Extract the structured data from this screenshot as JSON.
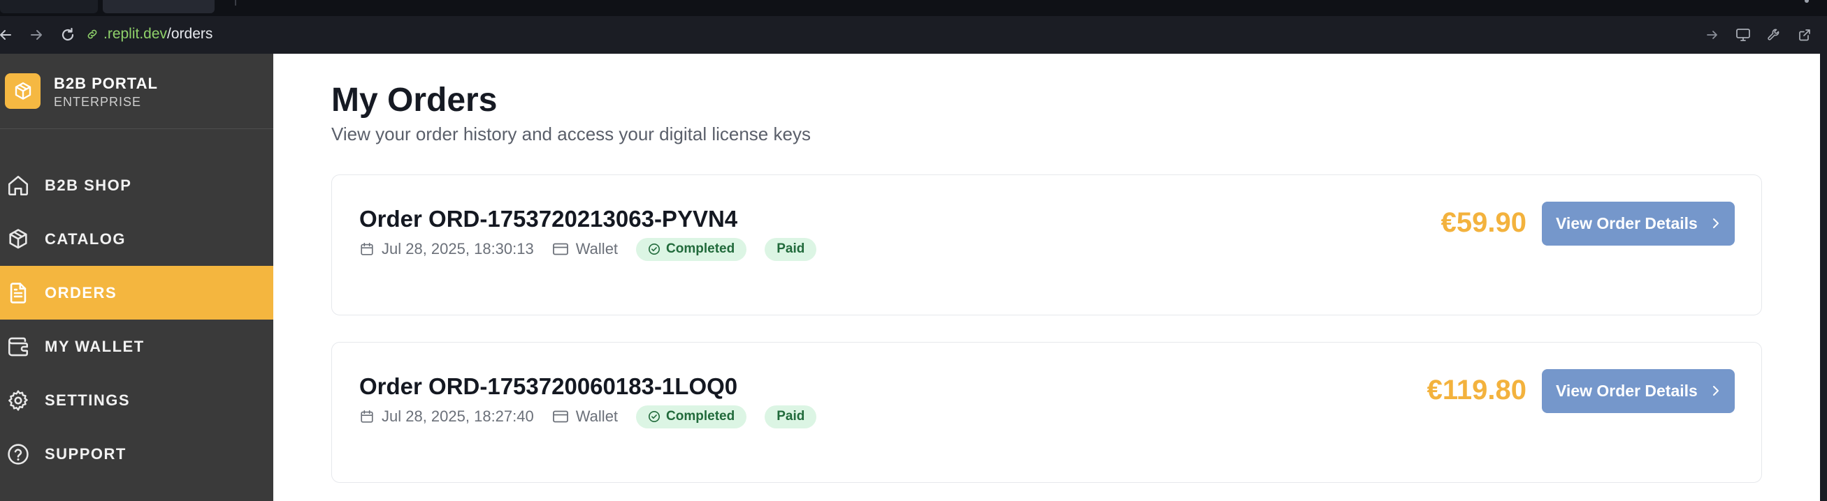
{
  "browser": {
    "url_host": ".replit.dev",
    "url_path": "/orders"
  },
  "sidebar": {
    "brand_title": "B2B PORTAL",
    "brand_subtitle": "ENTERPRISE",
    "items": [
      {
        "label": "B2B SHOP",
        "icon": "home-icon",
        "active": false
      },
      {
        "label": "CATALOG",
        "icon": "package-icon",
        "active": false
      },
      {
        "label": "ORDERS",
        "icon": "document-icon",
        "active": true
      },
      {
        "label": "MY WALLET",
        "icon": "wallet-icon",
        "active": false
      },
      {
        "label": "SETTINGS",
        "icon": "gear-icon",
        "active": false
      },
      {
        "label": "SUPPORT",
        "icon": "help-circle-icon",
        "active": false
      }
    ]
  },
  "main": {
    "title": "My Orders",
    "subtitle": "View your order history and access your digital license keys",
    "orders": [
      {
        "title": "Order ORD-1753720213063-PYVN4",
        "date": "Jul 28, 2025, 18:30:13",
        "payment_method": "Wallet",
        "status": "Completed",
        "payment_status": "Paid",
        "total": "€59.90",
        "button_label": "View Order Details"
      },
      {
        "title": "Order ORD-1753720060183-1LOQ0",
        "date": "Jul 28, 2025, 18:27:40",
        "payment_method": "Wallet",
        "status": "Completed",
        "payment_status": "Paid",
        "total": "€119.80",
        "button_label": "View Order Details"
      }
    ]
  },
  "colors": {
    "accent": "#f4b63f",
    "sidebar_bg": "#3a3a3a",
    "button_bg": "#7597cb",
    "badge_bg": "#dcf5e4",
    "badge_text": "#216a3b",
    "price": "#f3b23d"
  }
}
